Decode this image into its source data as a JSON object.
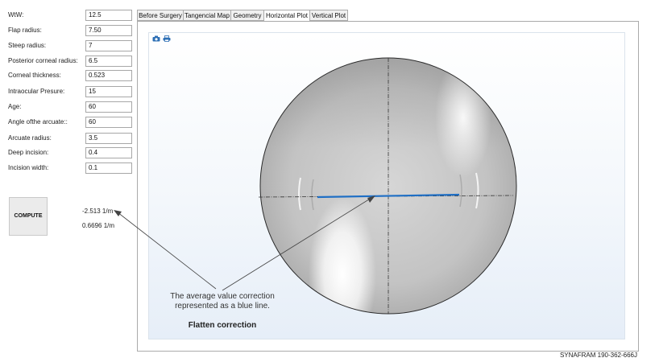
{
  "params": [
    {
      "label": "WtW:",
      "value": "12.5"
    },
    {
      "label": "Flap radius:",
      "value": "7.50"
    },
    {
      "label": "Steep radius:",
      "value": "7"
    },
    {
      "label": "Posterior corneal radius:",
      "value": "6.5"
    },
    {
      "label": "Corneal thickness:",
      "value": "0.523"
    },
    {
      "label": "Intraocular Presure:",
      "value": "15"
    },
    {
      "label": "Age:",
      "value": "60"
    },
    {
      "label": "Angle ofthe arcuate::",
      "value": "60"
    },
    {
      "label": "Arcuate radius:",
      "value": "3.5"
    },
    {
      "label": "Deep incision:",
      "value": "0.4"
    },
    {
      "label": "Incision width:",
      "value": "0.1"
    }
  ],
  "compute_label": "COMPUTE",
  "results": {
    "line1": "-2.513 1/m",
    "line2": "0.6696 1/m"
  },
  "tabs": [
    {
      "label": "Before Surgery"
    },
    {
      "label": "Tangencial Map"
    },
    {
      "label": "Geometry"
    },
    {
      "label": "Horizontal Plot"
    },
    {
      "label": "Vertical Plot"
    }
  ],
  "active_tab": "Horizontal Plot",
  "toolbar": {
    "icons": [
      "camera-icon",
      "print-icon"
    ]
  },
  "annotation": {
    "line1": "The average value correction",
    "line2": "represented as a blue line.",
    "title": "Flatten correction"
  },
  "footer": "SYNAFRAM  190-362-666J",
  "colors": {
    "accent_line": "#1f6fc5",
    "icon": "#2d6fb5"
  }
}
